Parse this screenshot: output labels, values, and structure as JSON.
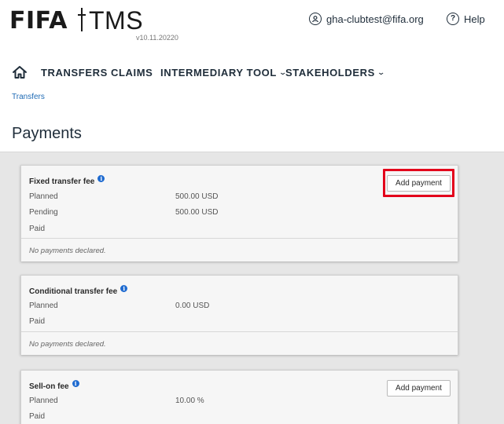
{
  "header": {
    "logo_fifa": "FIFA",
    "logo_tms": "TMS",
    "version": "v10.11.20220",
    "user_email": "gha-clubtest@fifa.org",
    "help_label": "Help"
  },
  "nav": {
    "items": [
      {
        "label": "TRANSFERS",
        "dropdown": false
      },
      {
        "label": "CLAIMS",
        "dropdown": false
      },
      {
        "label": "INTERMEDIARY TOOL",
        "dropdown": true
      },
      {
        "label": "STAKEHOLDERS",
        "dropdown": true
      }
    ]
  },
  "breadcrumb": "Transfers",
  "page_title": "Payments",
  "cards": [
    {
      "title": "Fixed transfer fee",
      "rows": [
        {
          "label": "Planned",
          "value": "500.00 USD"
        },
        {
          "label": "Pending",
          "value": "500.00 USD"
        },
        {
          "label": "Paid",
          "value": ""
        }
      ],
      "footer": "No payments declared.",
      "button": "Add payment",
      "highlighted": true
    },
    {
      "title": "Conditional transfer fee",
      "rows": [
        {
          "label": "Planned",
          "value": "0.00 USD"
        },
        {
          "label": "Paid",
          "value": ""
        }
      ],
      "footer": "No payments declared."
    },
    {
      "title": "Sell-on fee",
      "rows": [
        {
          "label": "Planned",
          "value": "10.00 %"
        },
        {
          "label": "Paid",
          "value": ""
        }
      ],
      "button": "Add payment"
    }
  ],
  "colors": {
    "highlight": "#e3001b",
    "link": "#1f6bb5",
    "info": "#1f6bd0",
    "panel": "#e6e6e6"
  }
}
